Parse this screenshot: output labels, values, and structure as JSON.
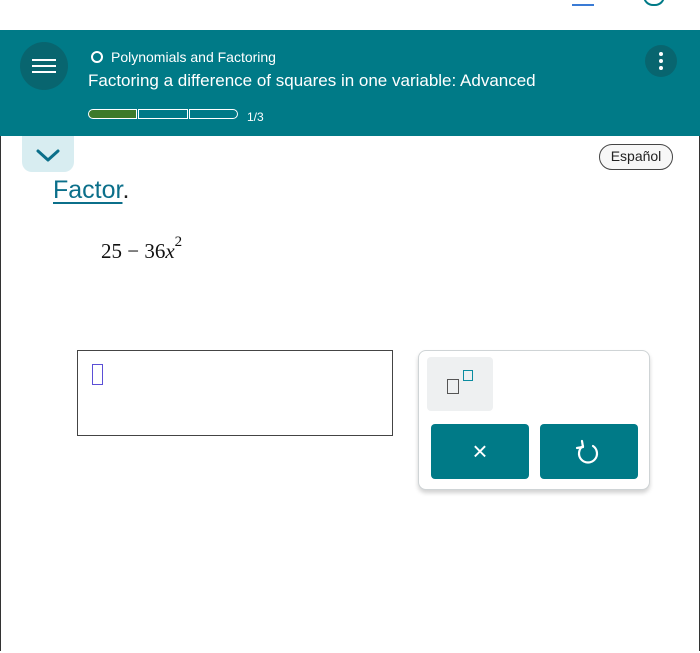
{
  "header": {
    "topic": "Polynomials and Factoring",
    "lesson_title": "Factoring a difference of squares in one variable: Advanced",
    "progress": {
      "label": "1/3",
      "segments_total": 3,
      "segments_filled": 1
    },
    "menu_icon": "hamburger-menu-icon",
    "more_icon": "vertical-ellipsis-icon"
  },
  "language_button": "Español",
  "question": {
    "prompt_word": "Factor",
    "prompt_punct": ".",
    "expression": {
      "left": "25 − 36",
      "var": "x",
      "exp": "2"
    }
  },
  "answer": {
    "value": ""
  },
  "keypad": {
    "exponent_icon": "superscript-template-icon",
    "clear_symbol": "×",
    "undo_icon": "undo-icon"
  },
  "colors": {
    "brand": "#007a87",
    "progress_fill": "#3c7a2a",
    "link": "#0b6f8a"
  }
}
